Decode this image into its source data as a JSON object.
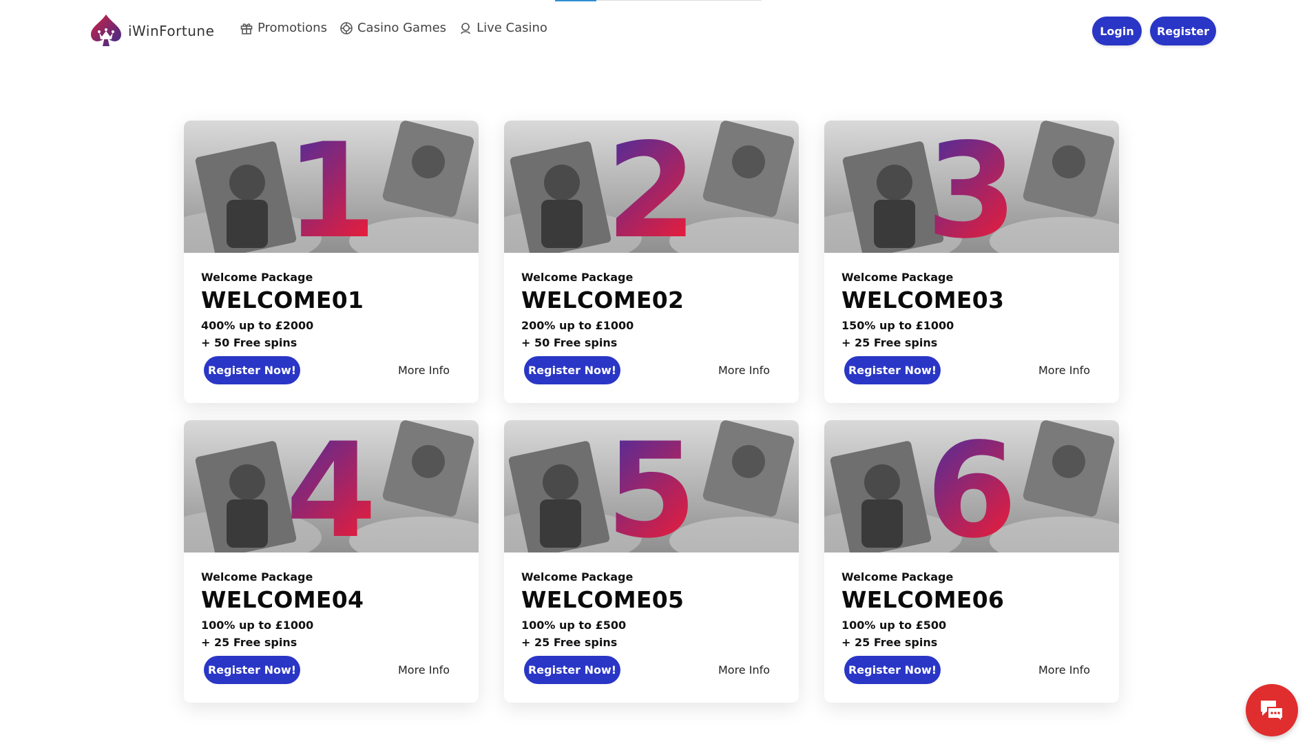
{
  "brand": {
    "name": "iWinFortune"
  },
  "nav": [
    {
      "label": "Promotions",
      "icon": "gift-icon"
    },
    {
      "label": "Casino Games",
      "icon": "chip-icon"
    },
    {
      "label": "Live Casino",
      "icon": "dealer-icon"
    }
  ],
  "header": {
    "login_label": "Login",
    "register_label": "Register"
  },
  "colors": {
    "primary": "#2a36c6",
    "chat": "#e02d2d",
    "numeral_start": "#3b2fa8",
    "numeral_end": "#e81d3a"
  },
  "cards": [
    {
      "number": "1",
      "label": "Welcome Package",
      "code": "WELCOME01",
      "line1": "400% up to £2000",
      "line2": "+ 50 Free spins",
      "cta": "Register Now!",
      "more": "More Info"
    },
    {
      "number": "2",
      "label": "Welcome Package",
      "code": "WELCOME02",
      "line1": "200% up to £1000",
      "line2": "+ 50 Free spins",
      "cta": "Register Now!",
      "more": "More Info"
    },
    {
      "number": "3",
      "label": "Welcome Package",
      "code": "WELCOME03",
      "line1": "150% up to £1000",
      "line2": "+ 25 Free spins",
      "cta": "Register Now!",
      "more": "More Info"
    },
    {
      "number": "4",
      "label": "Welcome Package",
      "code": "WELCOME04",
      "line1": "100% up to £1000",
      "line2": "+ 25 Free spins",
      "cta": "Register Now!",
      "more": "More Info"
    },
    {
      "number": "5",
      "label": "Welcome Package",
      "code": "WELCOME05",
      "line1": "100% up to £500",
      "line2": "+ 25 Free spins",
      "cta": "Register Now!",
      "more": "More Info"
    },
    {
      "number": "6",
      "label": "Welcome Package",
      "code": "WELCOME06",
      "line1": "100% up to £500",
      "line2": "+ 25 Free spins",
      "cta": "Register Now!",
      "more": "More Info"
    }
  ]
}
